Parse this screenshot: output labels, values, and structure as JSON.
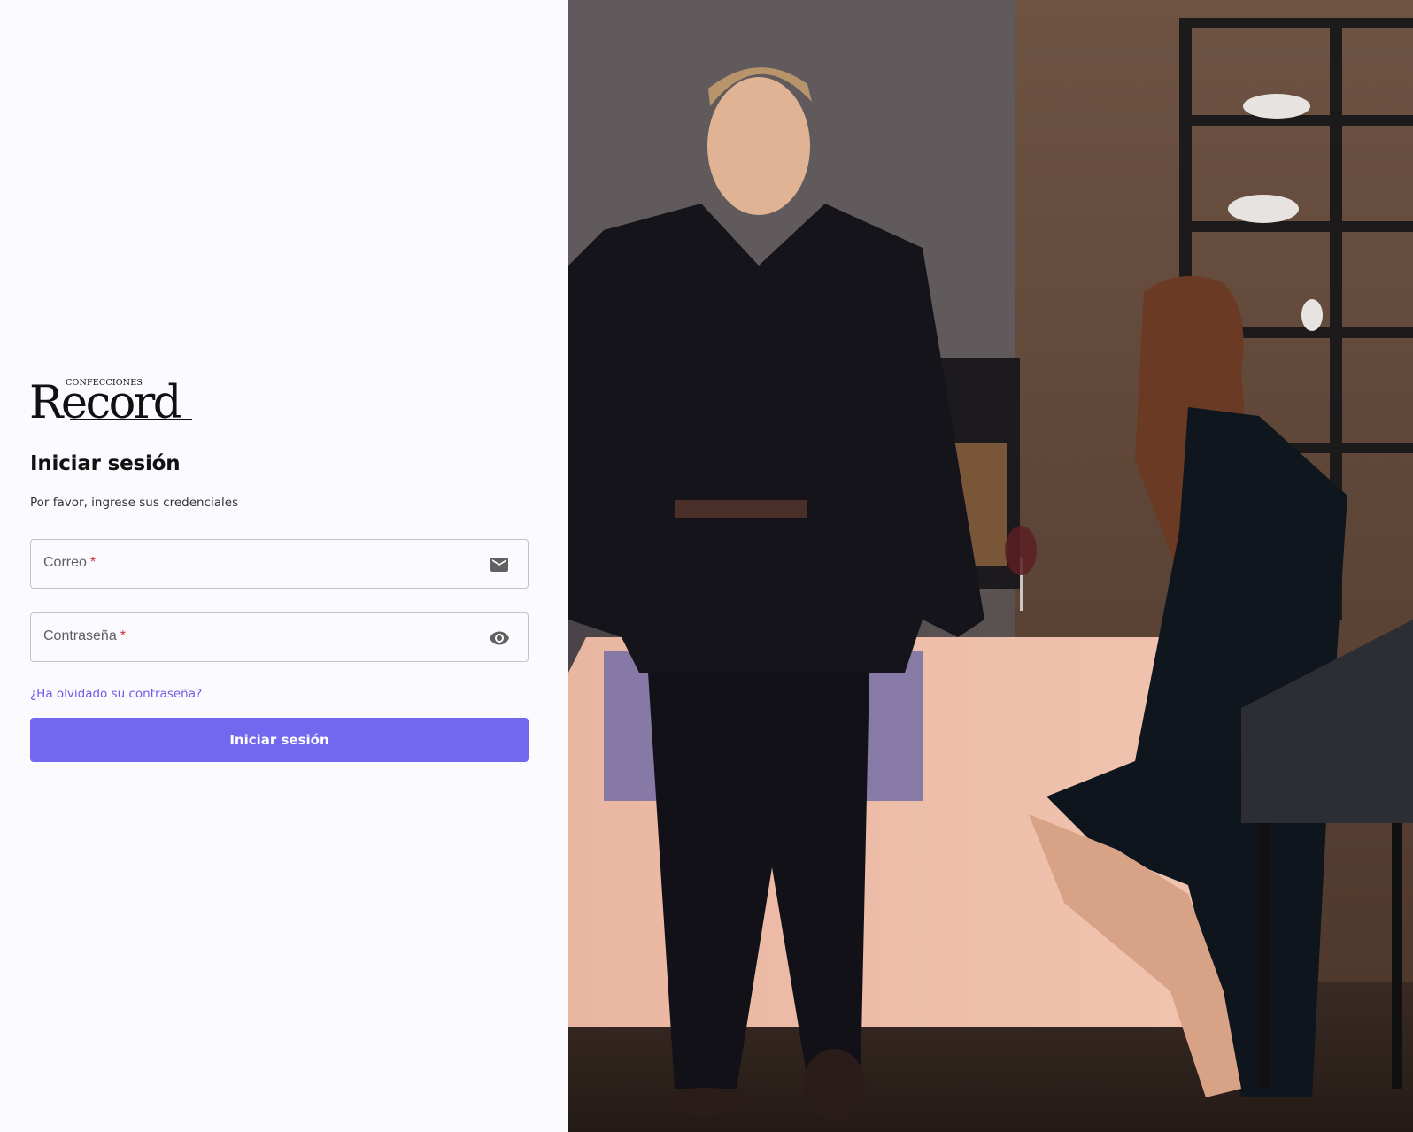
{
  "brand": {
    "small_text": "CONFECCIONES",
    "name": "Record"
  },
  "login": {
    "title": "Iniciar sesión",
    "subtitle": "Por favor, ingrese sus credenciales",
    "email_label": "Correo",
    "password_label": "Contraseña",
    "required_mark": "*",
    "forgot_password": "¿Ha olvidado su contraseña?",
    "submit_label": "Iniciar sesión"
  },
  "icons": {
    "email": "email-icon",
    "password_visibility": "eye-icon"
  },
  "colors": {
    "primary": "#7367f0",
    "link": "#6c5ce7",
    "required": "#d32f2f",
    "background": "#fbfaff"
  }
}
